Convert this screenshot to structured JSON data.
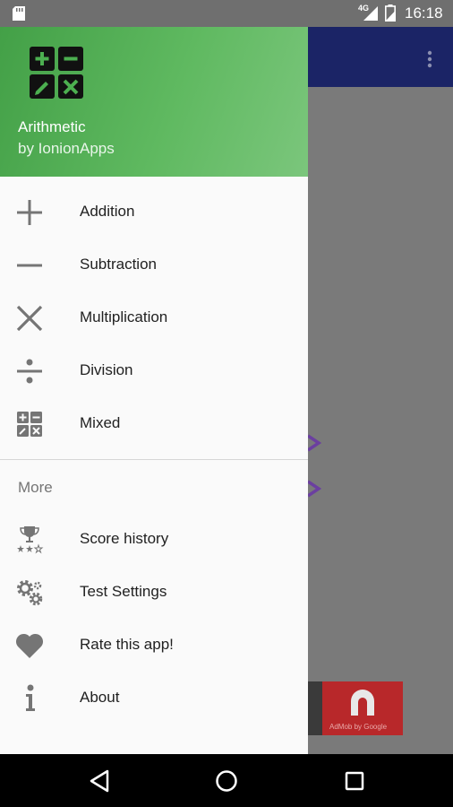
{
  "status_bar": {
    "network": "4G",
    "time": "16:18",
    "icons": [
      "sd-card-icon",
      "signal-icon",
      "battery-icon"
    ]
  },
  "drawer": {
    "header": {
      "app_name": "Arithmetic",
      "byline": "by IonionApps",
      "icon": "calculator-icon",
      "gradient_colors": [
        "#43a047",
        "#7bc67c"
      ]
    },
    "primary_items": [
      {
        "label": "Addition",
        "icon": "plus-icon"
      },
      {
        "label": "Subtraction",
        "icon": "minus-icon"
      },
      {
        "label": "Multiplication",
        "icon": "multiply-icon"
      },
      {
        "label": "Division",
        "icon": "divide-icon"
      },
      {
        "label": "Mixed",
        "icon": "calculator-icon"
      }
    ],
    "section_header": "More",
    "secondary_items": [
      {
        "label": "Score history",
        "icon": "trophy-icon"
      },
      {
        "label": "Test Settings",
        "icon": "gears-icon"
      },
      {
        "label": "Rate this app!",
        "icon": "heart-icon"
      },
      {
        "label": "About",
        "icon": "info-icon"
      }
    ]
  },
  "background": {
    "app_bar_color": "#1b2466",
    "ad_logo_text": "AdMob by Google"
  },
  "nav_bar": {
    "buttons": [
      "back-icon",
      "home-icon",
      "recents-icon"
    ]
  }
}
